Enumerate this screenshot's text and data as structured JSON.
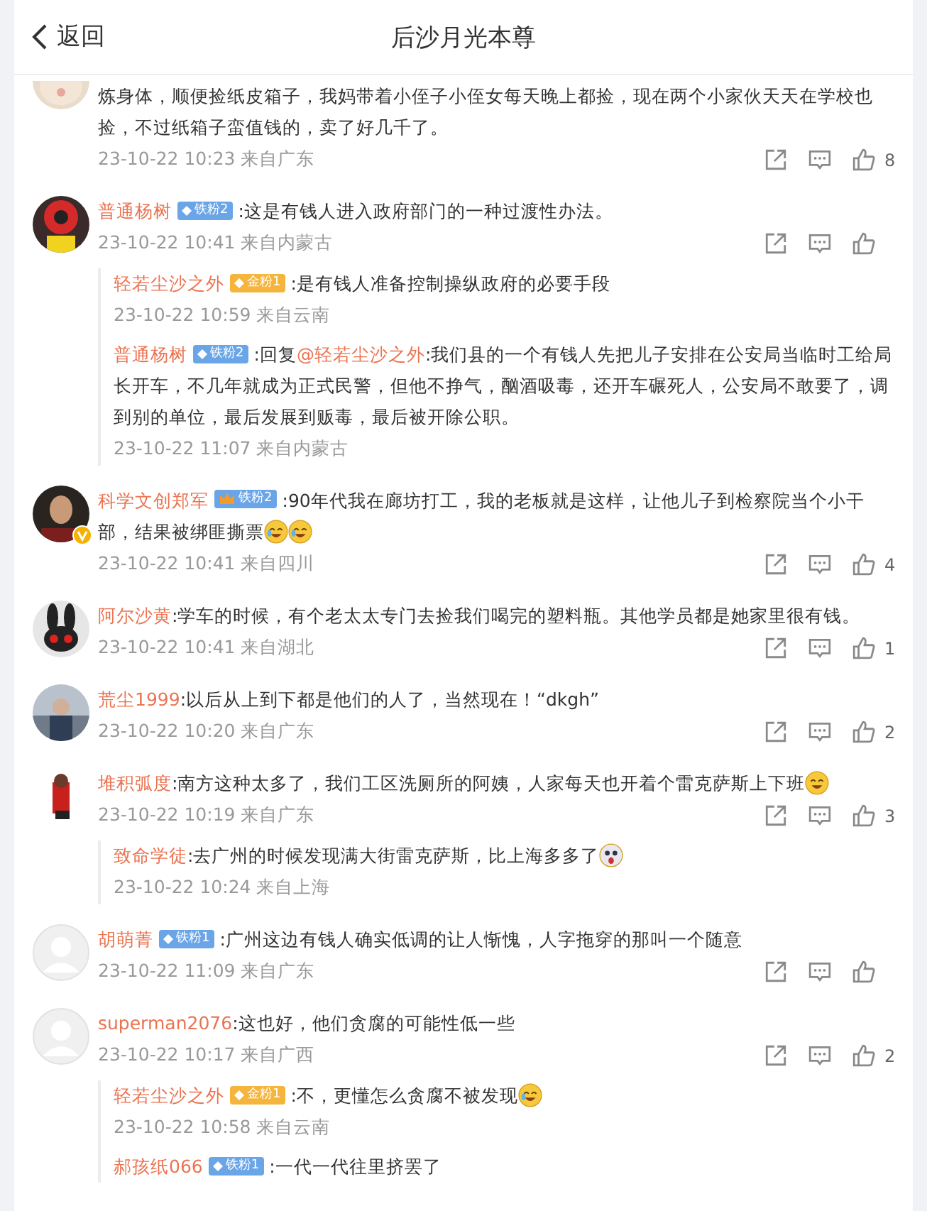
{
  "header": {
    "back": "返回",
    "title": "后沙月光本尊"
  },
  "comments": [
    {
      "avatar": {
        "kind": "cat"
      },
      "verified": false,
      "text": "炼身体，顺便捡纸皮箱子，我妈带着小侄子小侄女每天晚上都捡，现在两个小家伙天天在学校也捡，不过纸箱子蛮值钱的，卖了好几千了。",
      "time": "23-10-22 10:23 来自广东",
      "likes": "8",
      "cut_top": true
    },
    {
      "avatar": {
        "kind": "red"
      },
      "verified": false,
      "name": "普通杨树",
      "badge": {
        "kind": "iron",
        "label": "铁粉2",
        "crown": false
      },
      "text": ":这是有钱人进入政府部门的一种过渡性办法。",
      "time": "23-10-22 10:41 来自内蒙古",
      "cut_top": false,
      "replies": [
        {
          "name": "轻若尘沙之外",
          "badge": {
            "kind": "gold",
            "label": "金粉1",
            "crown": false
          },
          "text": ":是有钱人准备控制操纵政府的必要手段",
          "time": "23-10-22 10:59 来自云南"
        },
        {
          "name": "普通杨树",
          "badge": {
            "kind": "iron",
            "label": "铁粉2",
            "crown": false
          },
          "prefix": ":回复",
          "mention": "@轻若尘沙之外",
          "text": ":我们县的一个有钱人先把儿子安排在公安局当临时工给局长开车，不几年就成为正式民警，但他不挣气，酗酒吸毒，还开车碾死人，公安局不敢要了，调到别的单位，最后发展到贩毒，最后被开除公职。",
          "time": "23-10-22 11:07 来自内蒙古"
        }
      ]
    },
    {
      "avatar": {
        "kind": "man"
      },
      "verified": true,
      "name": "科学文创郑军",
      "badge": {
        "kind": "iron",
        "label": "铁粉2",
        "crown": true
      },
      "text": ":90年代我在廊坊打工，我的老板就是这样，让他儿子到检察院当个小干部，结果被绑匪撕票",
      "emojis": [
        {
          "kind": "laugh-cry"
        },
        {
          "kind": "laugh-cry"
        }
      ],
      "time": "23-10-22 10:41 来自四川",
      "likes": "4",
      "cut_top": false
    },
    {
      "avatar": {
        "kind": "rabbit"
      },
      "verified": false,
      "name": "阿尔沙黄",
      "text": ":学车的时候，有个老太太专门去捡我们喝完的塑料瓶。其他学员都是她家里很有钱。",
      "time": "23-10-22 10:41 来自湖北",
      "likes": "1",
      "cut_top": false
    },
    {
      "verified": false,
      "name": "荒尘1999",
      "text": ":以后从上到下都是他们的人了，当然现在！“dkgh”",
      "time": "23-10-22 10:20 来自广东",
      "likes": "2",
      "cut_top": false
    },
    {
      "avatar": {
        "kind": "figure"
      },
      "verified": false,
      "name": "堆积弧度",
      "text": ":南方这种太多了，我们工区洗厕所的阿姨，人家每天也开着个雷克萨斯上下班",
      "emojis": [
        {
          "kind": "laugh"
        }
      ],
      "time": "23-10-22 10:19 来自广东",
      "likes": "3",
      "cut_top": false,
      "replies": [
        {
          "name": "致命学徒",
          "text": ":去广州的时候发现满大街雷克萨斯，比上海多多了",
          "emojis": [
            {
              "kind": "shock"
            }
          ],
          "time": "23-10-22 10:24 来自上海"
        }
      ]
    },
    {
      "avatar": {
        "kind": "default"
      },
      "verified": false,
      "name": "胡萌菁",
      "badge": {
        "kind": "iron",
        "label": "铁粉1",
        "crown": false
      },
      "text": ":广州这边有钱人确实低调的让人惭愧，人字拖穿的那叫一个随意",
      "time": "23-10-22 11:09 来自广东",
      "cut_top": false
    },
    {
      "avatar": {
        "kind": "default"
      },
      "verified": false,
      "name": "superman2076",
      "text": ":这也好，他们贪腐的可能性低一些",
      "time": "23-10-22 10:17 来自广西",
      "likes": "2",
      "cut_top": false,
      "replies": [
        {
          "name": "轻若尘沙之外",
          "badge": {
            "kind": "gold",
            "label": "金粉1",
            "crown": false
          },
          "text": ":不，更懂怎么贪腐不被发现",
          "emojis": [
            {
              "kind": "laugh-cry"
            }
          ],
          "time": "23-10-22 10:58 来自云南"
        },
        {
          "name": "郝孩纸066",
          "badge": {
            "kind": "iron",
            "label": "铁粉1",
            "crown": false
          },
          "text": ":一代一代往里挤罢了"
        }
      ]
    }
  ]
}
